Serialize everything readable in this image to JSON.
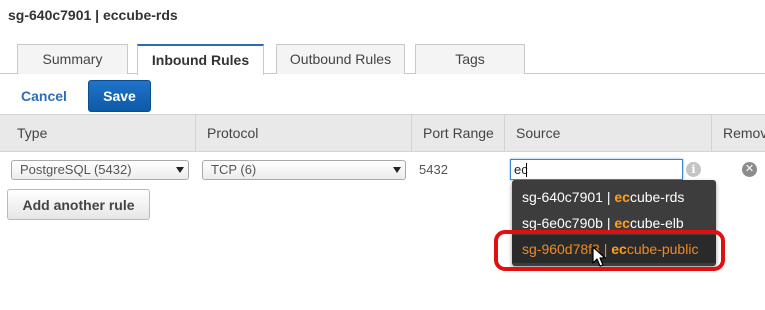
{
  "window": {
    "title": "sg-640c7901 | eccube-rds"
  },
  "tabs": [
    {
      "label": "Summary",
      "active": false
    },
    {
      "label": "Inbound Rules",
      "active": true
    },
    {
      "label": "Outbound Rules",
      "active": false
    },
    {
      "label": "Tags",
      "active": false
    }
  ],
  "actions": {
    "cancel_label": "Cancel",
    "save_label": "Save"
  },
  "table": {
    "columns": [
      "Type",
      "Protocol",
      "Port Range",
      "Source",
      "Remove"
    ],
    "rows": [
      {
        "type": "PostgreSQL (5432)",
        "protocol": "TCP (6)",
        "port_range": "5432",
        "source": "ec"
      }
    ]
  },
  "add_rule_label": "Add another rule",
  "autocomplete": {
    "items": [
      {
        "id": "sg-640c7901",
        "sep": " | ",
        "match": "ec",
        "rest": "cube-rds"
      },
      {
        "id": "sg-6e0c790b",
        "sep": " | ",
        "match": "ec",
        "rest": "cube-elb"
      },
      {
        "id": "sg-960d78f3",
        "sep": " | ",
        "match": "ec",
        "rest": "cube-public",
        "hovered": true
      }
    ]
  },
  "icons": {
    "info": "info-icon",
    "remove": "remove-circle-icon",
    "dropdown": "chevron-down-icon",
    "cursor": "mouse-pointer-icon"
  },
  "colors": {
    "accent": "#2a6ebb",
    "primary_button": "#1666ba",
    "match_highlight": "#ff9f1a",
    "annotation": "#e10f0f"
  }
}
